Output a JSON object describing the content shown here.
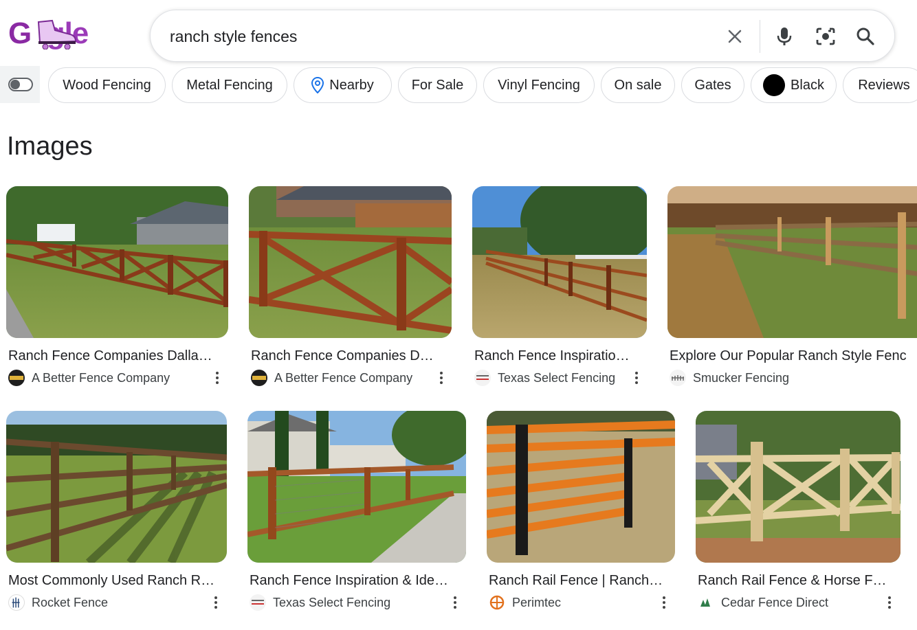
{
  "logo": {
    "text": "Gigle",
    "colors": [
      "#8a2aa3",
      "#c06cd8"
    ]
  },
  "search": {
    "query": "ranch style fences",
    "icons": [
      "close-icon",
      "microphone-icon",
      "camera-lens-icon",
      "search-icon"
    ]
  },
  "chips": [
    {
      "label": "Wood Fencing"
    },
    {
      "label": "Metal Fencing"
    },
    {
      "label": "Nearby",
      "icon": "location-pin-icon"
    },
    {
      "label": "For Sale"
    },
    {
      "label": "Vinyl Fencing"
    },
    {
      "label": "On sale"
    },
    {
      "label": "Gates"
    },
    {
      "label": "Black",
      "icon": "black-swatch-icon"
    },
    {
      "label": "Reviews"
    }
  ],
  "section_title": "Images",
  "results": [
    {
      "title": "Ranch Fence Companies Dalla…",
      "source": "A Better Fence Company",
      "favicon": "better-fence-icon"
    },
    {
      "title": "Ranch Fence Companies D…",
      "source": "A Better Fence Company",
      "favicon": "better-fence-icon"
    },
    {
      "title": "Ranch Fence Inspiratio…",
      "source": "Texas Select Fencing",
      "favicon": "texas-select-icon"
    },
    {
      "title": "Explore Our Popular Ranch Style Fenc",
      "source": "Smucker Fencing",
      "favicon": "smucker-icon"
    },
    {
      "title": "Most Commonly Used Ranch R…",
      "source": "Rocket Fence",
      "favicon": "rocket-fence-icon"
    },
    {
      "title": "Ranch Fence Inspiration & Ide…",
      "source": "Texas Select Fencing",
      "favicon": "texas-select-icon"
    },
    {
      "title": "Ranch Rail Fence | Ranch…",
      "source": "Perimtec",
      "favicon": "perimtec-icon"
    },
    {
      "title": "Ranch Rail Fence & Horse F…",
      "source": "Cedar Fence Direct",
      "favicon": "cedar-fence-icon"
    }
  ]
}
